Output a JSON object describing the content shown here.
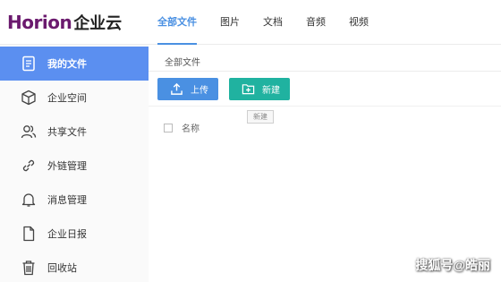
{
  "logo": {
    "brand": "Horion",
    "suffix": "企业云",
    "brand_color": "#6b1a6e"
  },
  "tabs": [
    {
      "label": "全部文件",
      "active": true
    },
    {
      "label": "图片",
      "active": false
    },
    {
      "label": "文档",
      "active": false
    },
    {
      "label": "音频",
      "active": false
    },
    {
      "label": "视频",
      "active": false
    }
  ],
  "sidebar": {
    "items": [
      {
        "label": "我的文件",
        "icon": "document-icon",
        "active": true
      },
      {
        "label": "企业空间",
        "icon": "cube-icon",
        "active": false
      },
      {
        "label": "共享文件",
        "icon": "users-icon",
        "active": false
      },
      {
        "label": "外链管理",
        "icon": "link-icon",
        "active": false
      },
      {
        "label": "消息管理",
        "icon": "bell-icon",
        "active": false
      },
      {
        "label": "企业日报",
        "icon": "report-icon",
        "active": false
      },
      {
        "label": "回收站",
        "icon": "trash-icon",
        "active": false
      }
    ]
  },
  "main": {
    "breadcrumb": "全部文件",
    "upload_label": "上传",
    "new_label": "新建",
    "tooltip": "新建",
    "column_name": "名称"
  },
  "watermark": "搜狐号@皓丽",
  "colors": {
    "accent": "#4a90e2",
    "sidebar_active": "#5b8ff0",
    "new_button": "#20b2a0"
  }
}
